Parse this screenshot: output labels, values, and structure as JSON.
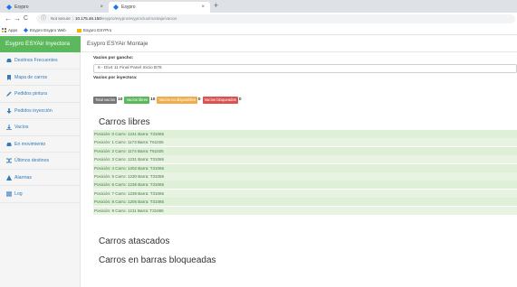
{
  "browser": {
    "tabs": [
      {
        "title": "Esypro",
        "active": false
      },
      {
        "title": "Esypro",
        "active": true
      }
    ],
    "new_tab_glyph": "+",
    "close_glyph": "×",
    "back_glyph": "←",
    "forward_glyph": "→",
    "reload_glyph": "C",
    "url_security": "Not secure",
    "url_host": "10.175.46.150",
    "url_path": "/esypro/esypro/esyproclus/montaje/vacios",
    "bookmarks": [
      "Apps",
      "Esypro Esypro Web",
      "Esypro ESYPro"
    ]
  },
  "app": {
    "brand": "Esypro ESYAir Inyectora",
    "header_title": "Esypro ESYAir Montaje",
    "menu": [
      {
        "label": "Destinos Frecuentes",
        "icon": "car-icon"
      },
      {
        "label": "Mapa de carros",
        "icon": "bookmark-icon"
      },
      {
        "label": "Pedidos pintura",
        "icon": "pencil-icon"
      },
      {
        "label": "Pedidos inyección",
        "icon": "arrow-down-icon"
      },
      {
        "label": "Vacíos",
        "icon": "download-icon"
      },
      {
        "label": "En movimiento",
        "icon": "car-icon"
      },
      {
        "label": "Últimos destinos",
        "icon": "shuffle-icon"
      },
      {
        "label": "Alarmas",
        "icon": "warning-icon"
      },
      {
        "label": "Log",
        "icon": "list-icon"
      }
    ]
  },
  "form": {
    "hook_label": "Vacíos por gancho:",
    "hook_value": "6 - Div4 11 Final Panel Inicio B76",
    "injector_label": "Vacíos por inyectora:"
  },
  "status": {
    "badges": [
      {
        "label": "Total vacíos",
        "count": "10",
        "color": "#777777"
      },
      {
        "label": "Vacíos libres",
        "count": "10",
        "color": "#5cb85c"
      },
      {
        "label": "Vacíos no disponibles",
        "count": "0",
        "color": "#f0ad4e"
      },
      {
        "label": "Vacíos bloqueados",
        "count": "0",
        "color": "#d9534f"
      }
    ]
  },
  "sections": {
    "free_title": "Carros libres",
    "stuck_title": "Carros atascados",
    "blocked_title": "Carros en barras bloqueadas"
  },
  "free_cars": [
    "Posición: 0 Carro: 1241 Barra: T31065",
    "Posición: 1 Carro: 1173 Barra: T61025",
    "Posición: 2 Carro: 1174 Barra: T61025",
    "Posición: 3 Carro: 1231 Barra: T31065",
    "Posición: 4 Carro: 1202 Barra: T31065",
    "Posición: 5 Carro: 1230 Barra: T31065",
    "Posición: 6 Carro: 1236 Barra: T31065",
    "Posición: 7 Carro: 1239 Barra: T31065",
    "Posición: 8 Carro: 1205 Barra: T31065",
    "Posición: 9 Carro: 1211 Barra: T31065"
  ],
  "colors": {
    "brand_green": "#5cb85c",
    "link_blue": "#337ab7",
    "row_green": "#dff0d8",
    "row_text": "#3c763d"
  }
}
